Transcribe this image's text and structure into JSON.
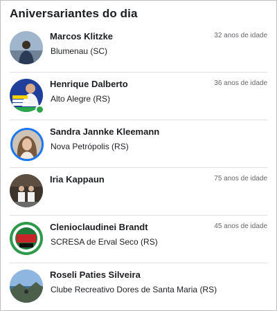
{
  "widget": {
    "title": "Aniversariantes do dia"
  },
  "people": [
    {
      "name": "Marcos Klitzke",
      "location": "Blumenau (SC)",
      "age": "32 anos de idade",
      "avatar_icon": "person-photo-icon"
    },
    {
      "name": "Henrique Dalberto",
      "location": "Alto Alegre (RS)",
      "age": "36 anos de idade",
      "avatar_icon": "campaign-photo-icon",
      "avatar_text": "40040 Henrique Dalberto",
      "online": true
    },
    {
      "name": "Sandra Jannke Kleemann",
      "location": "Nova Petrópolis (RS)",
      "age": "",
      "avatar_icon": "person-photo-icon",
      "story_ring": true
    },
    {
      "name": "Iria Kappaun",
      "location": "",
      "age": "75 anos de idade",
      "avatar_icon": "group-photo-icon"
    },
    {
      "name": "Clenioclaudinei Brandt",
      "location": "SCRESA de Erval Seco (RS)",
      "age": "45 anos de idade",
      "avatar_icon": "club-logo-icon"
    },
    {
      "name": "Roseli Paties Silveira",
      "location": "Clube Recreativo Dores de Santa Maria (RS)",
      "age": "",
      "avatar_icon": "landscape-photo-icon"
    }
  ],
  "colors": {
    "story_ring": "#1877f2",
    "online": "#31a24c",
    "secondary_text": "#65676b"
  }
}
